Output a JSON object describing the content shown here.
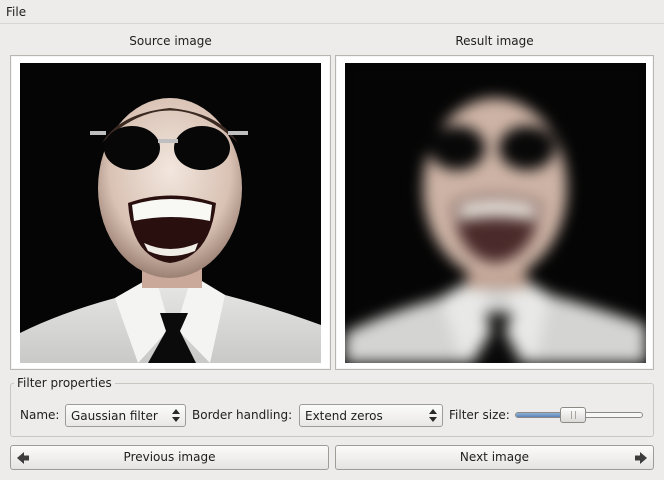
{
  "menubar": {
    "file": "File"
  },
  "source": {
    "caption": "Source image"
  },
  "result": {
    "caption": "Result image"
  },
  "filter_properties": {
    "title": "Filter properties",
    "name_label": "Name:",
    "name_value": "Gaussian filter",
    "border_label": "Border handling:",
    "border_value": "Extend zeros",
    "size_label": "Filter size:",
    "size_fraction": 0.45
  },
  "buttons": {
    "previous": "Previous image",
    "next": "Next image"
  },
  "colors": {
    "window": "#edeceb",
    "slider_fill": "#6f95c6",
    "image_bg": "#050505"
  }
}
